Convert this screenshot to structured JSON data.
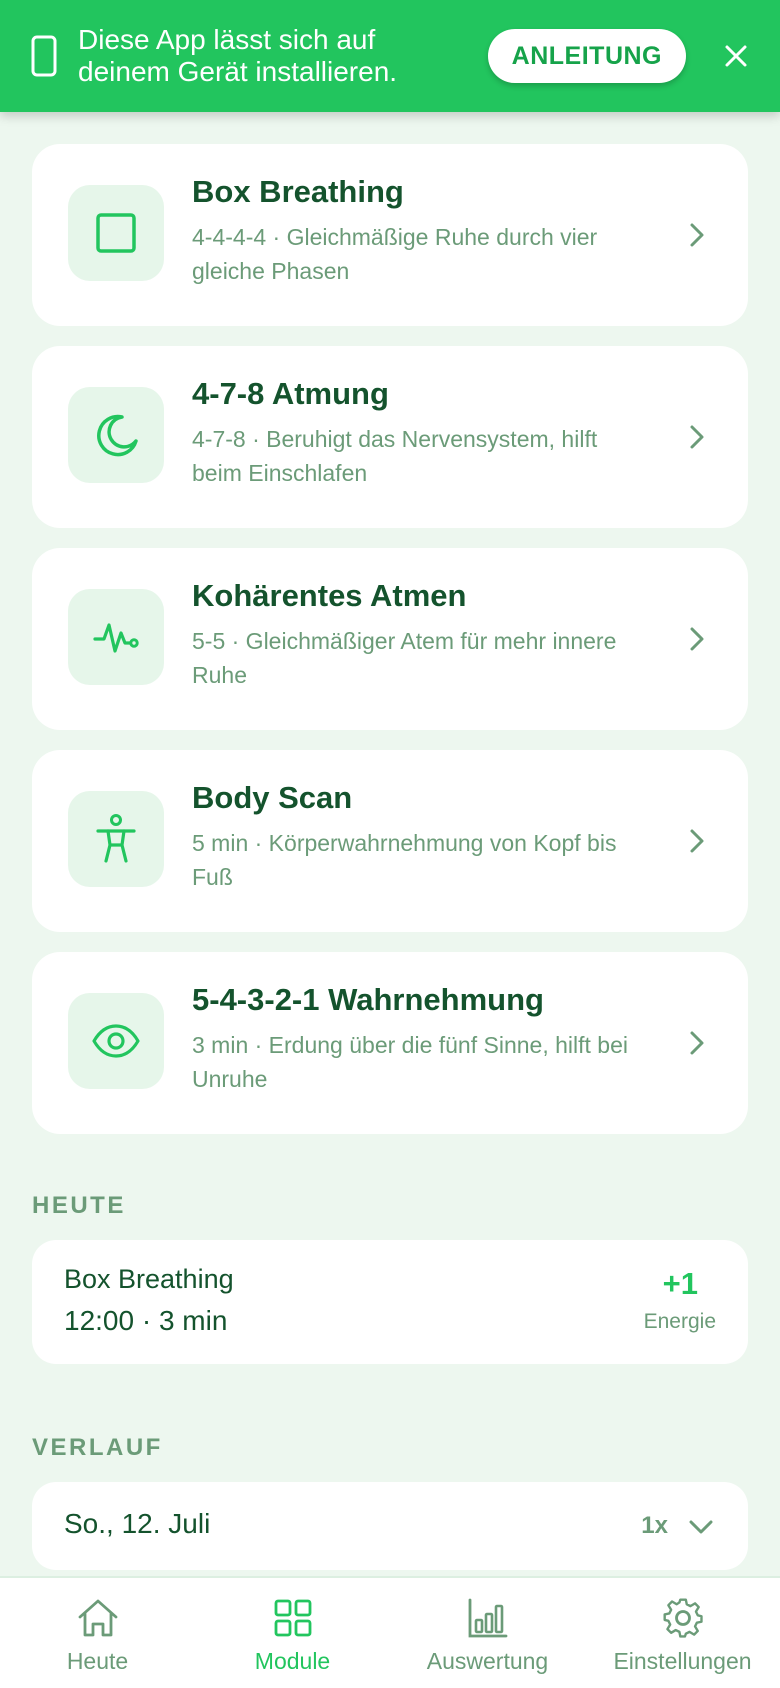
{
  "banner": {
    "message_line1": "Diese App lässt sich auf",
    "message_line2": "deinem Gerät installieren.",
    "guide_label": "ANLEITUNG"
  },
  "modules": [
    {
      "title": "Box Breathing",
      "description": "4-4-4-4 · Gleichmäßige Ruhe durch vier gleiche Phasen",
      "icon": "square-icon"
    },
    {
      "title": "4-7-8 Atmung",
      "description": "4-7-8 · Beruhigt das Nervensystem, hilft beim Einschlafen",
      "icon": "moon-icon"
    },
    {
      "title": "Kohärentes Atmen",
      "description": "5-5 · Gleichmäßiger Atem für mehr innere Ruhe",
      "icon": "heartbeat-icon"
    },
    {
      "title": "Body Scan",
      "description": "5 min · Körperwahrnehmung von Kopf bis Fuß",
      "icon": "person-icon"
    },
    {
      "title": "5-4-3-2-1 Wahrnehmung",
      "description": "3 min · Erdung über die fünf Sinne, hilft bei Unruhe",
      "icon": "eye-icon"
    }
  ],
  "today": {
    "label": "HEUTE",
    "entry": {
      "name": "Box Breathing",
      "time": "12:00 · 3 min",
      "points": "+1",
      "unit": "Energie"
    }
  },
  "history": {
    "label": "VERLAUF",
    "entry": {
      "date": "So., 12. Juli",
      "count": "1x"
    }
  },
  "nav": {
    "items": [
      {
        "label": "Heute",
        "icon": "home-icon",
        "active": false
      },
      {
        "label": "Module",
        "icon": "grid-icon",
        "active": true
      },
      {
        "label": "Auswertung",
        "icon": "bar-chart-icon",
        "active": false
      },
      {
        "label": "Einstellungen",
        "icon": "gear-icon",
        "active": false
      }
    ]
  },
  "colors": {
    "accent": "#22c55e",
    "background": "#edf7ef",
    "title_text": "#14532d",
    "muted_text": "#6b9b78"
  }
}
